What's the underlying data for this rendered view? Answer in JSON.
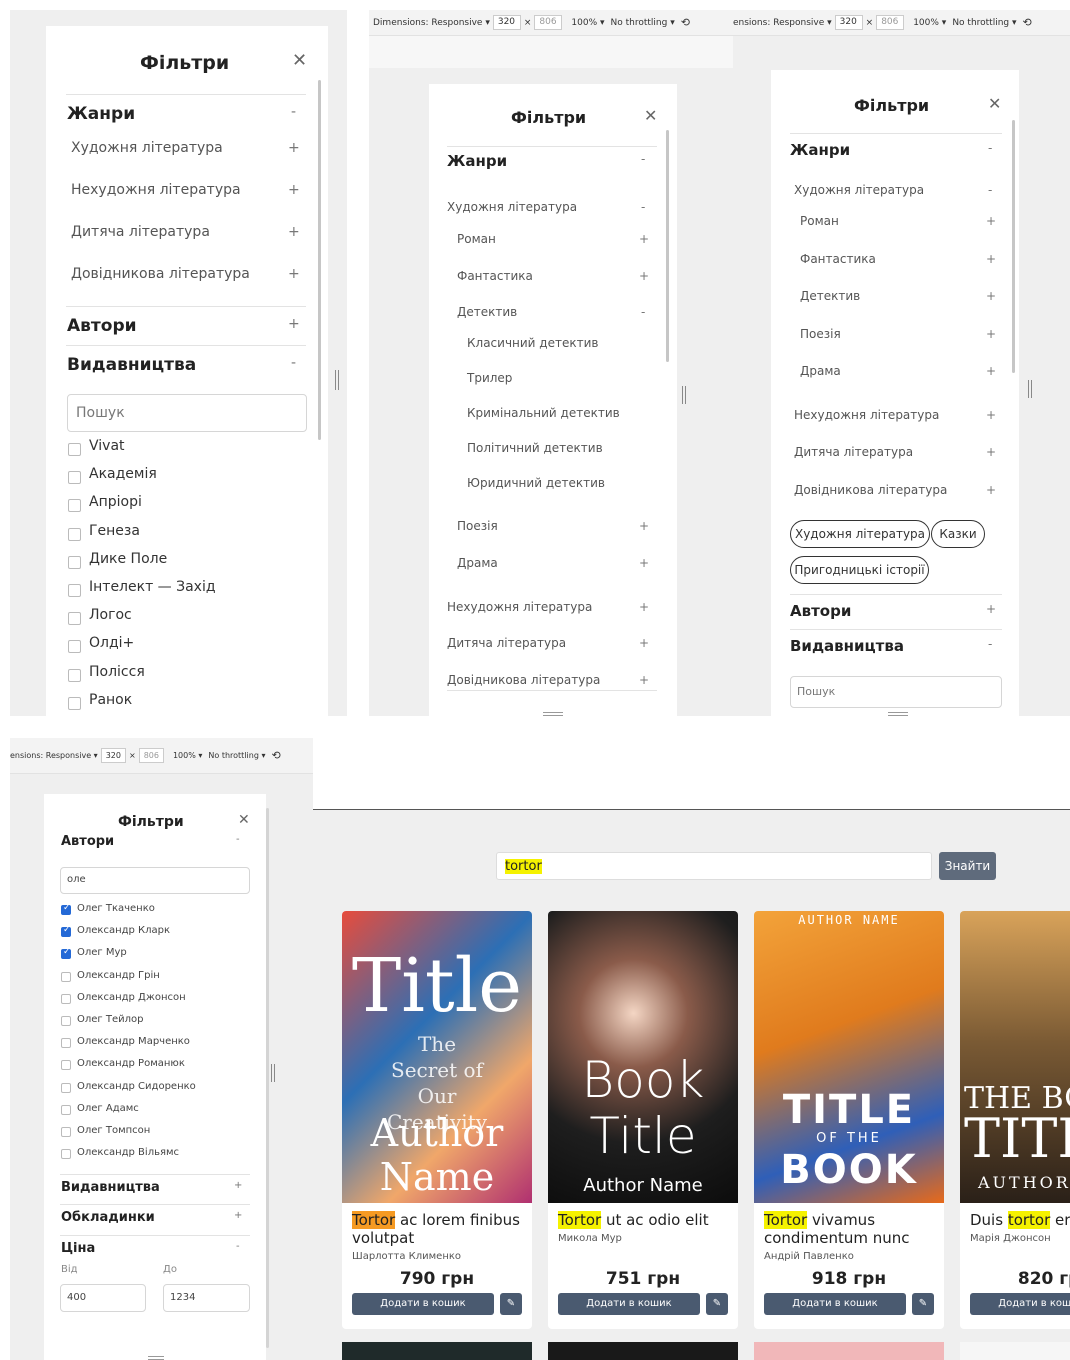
{
  "devtools": {
    "dimensions_label": "Dimensions: Responsive ▾",
    "dimensions_label_cut": "ensions: Responsive ▾",
    "width": "320",
    "x_sep": "×",
    "height": "806",
    "zoom": "100% ▾",
    "throttling": "No throttling ▾"
  },
  "filters_title": "Фільтри",
  "close_glyph": "✕",
  "plus": "+",
  "minus": "-",
  "genres": {
    "title": "Жанри",
    "fiction": "Художня література",
    "nonfiction": "Нехудожня література",
    "children": "Дитяча література",
    "reference": "Довідникова література",
    "roman": "Роман",
    "fantasy": "Фантастика",
    "detective": "Детектив",
    "poetry": "Поезія",
    "drama": "Драма",
    "classic_detective": "Класичний детектив",
    "thriller": "Трилер",
    "crime_detective": "Кримінальний детектив",
    "political_detective": "Політичний детектив",
    "legal_detective": "Юридичний детектив"
  },
  "authors_title": "Автори",
  "publishers_title": "Видавництва",
  "covers_title": "Обкладинки",
  "price_title": "Ціна",
  "search_placeholder": "Пошук",
  "publishers": [
    "Vivat",
    "Академія",
    "Апріорі",
    "Генеза",
    "Дике Поле",
    "Інтелект — Захід",
    "Логос",
    "Олді+",
    "Полісся",
    "Ранок"
  ],
  "chips": [
    "Художня література",
    "Казки",
    "Пригодницькі історії"
  ],
  "author_search_value": "оле",
  "authors": [
    {
      "name": "Олег Ткаченко",
      "checked": true
    },
    {
      "name": "Олександр Кларк",
      "checked": true
    },
    {
      "name": "Олег Мур",
      "checked": true
    },
    {
      "name": "Олександр Грін",
      "checked": false
    },
    {
      "name": "Олександр Джонсон",
      "checked": false
    },
    {
      "name": "Олег Тейлор",
      "checked": false
    },
    {
      "name": "Олександр Марченко",
      "checked": false
    },
    {
      "name": "Олександр Романюк",
      "checked": false
    },
    {
      "name": "Олександр Сидоренко",
      "checked": false
    },
    {
      "name": "Олег Адамс",
      "checked": false
    },
    {
      "name": "Олег Томпсон",
      "checked": false
    },
    {
      "name": "Олександр Вільямс",
      "checked": false
    }
  ],
  "price": {
    "from_label": "Від",
    "to_label": "До",
    "from_value": "400",
    "to_value": "1234"
  },
  "shop": {
    "search_value": "tortor",
    "search_button": "Знайти",
    "add_to_cart": "Додати в кошик",
    "edit_glyph": "✎",
    "cards": [
      {
        "title_hl": "Tortor",
        "title_rest": " ac lorem finibus volutpat",
        "author": "Шарлотта Клименко",
        "price": "790 грн",
        "cover": {
          "l1": "Title",
          "l2": "The Secret of Our Creativity",
          "l3": "Author Name"
        }
      },
      {
        "title_hl": "Tortor",
        "title_rest": " ut ac odio elit",
        "author": "Микола Мур",
        "price": "751 грн",
        "cover": {
          "l1": "Book",
          "l2": "Title",
          "l3": "Author Name"
        }
      },
      {
        "title_hl": "Tortor",
        "title_rest": " vivamus condimentum nunc",
        "author": "Андрій Павленко",
        "price": "918 грн",
        "cover": {
          "l0": "AUTHOR NAME",
          "l1": "TITLE",
          "l2": "OF THE",
          "l3": "BOOK"
        }
      },
      {
        "title_pre": "Duis ",
        "title_hl": "tortor",
        "title_rest": " erat",
        "author": "Марія Джонсон",
        "price": "820 грн",
        "cover": {
          "l1": "THE BO",
          "l2": "TITL",
          "l3": "AUTHOR"
        }
      }
    ]
  }
}
